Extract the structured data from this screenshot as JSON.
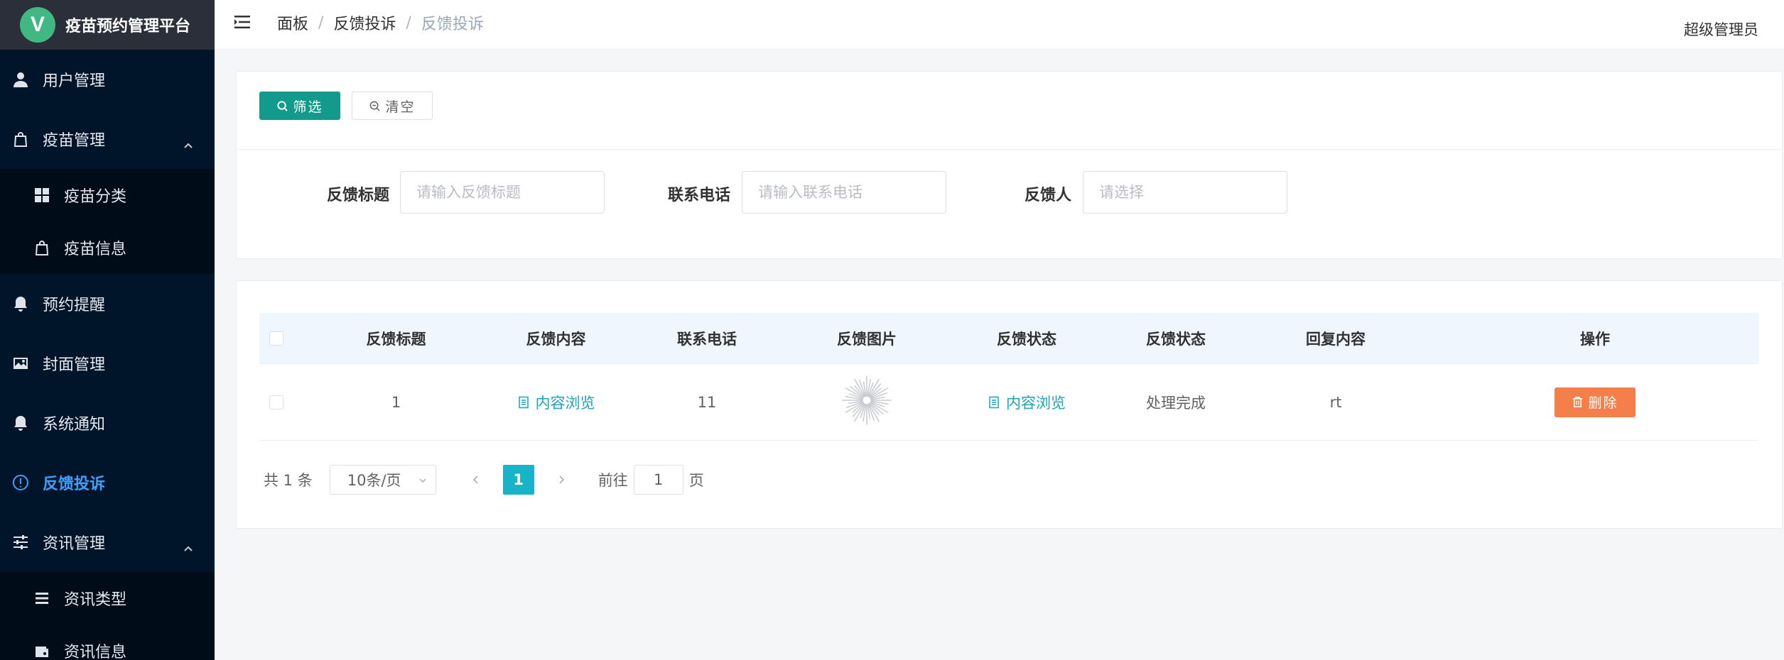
{
  "app": {
    "logo_letter": "V",
    "title": "疫苗预约管理平台"
  },
  "sidebar": {
    "items": [
      {
        "label": "用户管理",
        "icon": "user-icon"
      },
      {
        "label": "疫苗管理",
        "icon": "bag-icon",
        "expanded": true,
        "children": [
          {
            "label": "疫苗分类",
            "icon": "grid-icon"
          },
          {
            "label": "疫苗信息",
            "icon": "bag-icon"
          }
        ]
      },
      {
        "label": "预约提醒",
        "icon": "bell-icon"
      },
      {
        "label": "封面管理",
        "icon": "picture-icon"
      },
      {
        "label": "系统通知",
        "icon": "bell-icon"
      },
      {
        "label": "反馈投诉",
        "icon": "warning-circle-icon",
        "active": true
      },
      {
        "label": "资讯管理",
        "icon": "sliders-icon",
        "expanded": true,
        "children": [
          {
            "label": "资讯类型",
            "icon": "list-icon"
          },
          {
            "label": "资讯信息",
            "icon": "wallet-icon"
          }
        ]
      }
    ]
  },
  "header": {
    "breadcrumb": [
      "面板",
      "反馈投诉",
      "反馈投诉"
    ],
    "separator": "/",
    "user": "超级管理员"
  },
  "filter": {
    "filter_button": "筛选",
    "clear_button": "清空",
    "fields": [
      {
        "label": "反馈标题",
        "placeholder": "请输入反馈标题"
      },
      {
        "label": "联系电话",
        "placeholder": "请输入联系电话"
      },
      {
        "label": "反馈人",
        "placeholder": "请选择"
      }
    ]
  },
  "table": {
    "columns": [
      "反馈标题",
      "反馈内容",
      "联系电话",
      "反馈图片",
      "反馈状态",
      "反馈状态",
      "回复内容",
      "操作"
    ],
    "rows": [
      {
        "title": "1",
        "content_link": "内容浏览",
        "phone": "11",
        "image": "loading-spinner",
        "state_link": "内容浏览",
        "state_text": "处理完成",
        "reply": "rt",
        "delete_label": "删除"
      }
    ]
  },
  "pagination": {
    "total": "共 1 条",
    "page_size": "10条/页",
    "current_page": "1",
    "goto_prefix": "前往",
    "goto_value": "1",
    "goto_suffix": "页"
  },
  "colors": {
    "sidebar_bg": "#001529",
    "active": "#409eff",
    "primary": "#129a8c",
    "link": "#17a5b8",
    "danger": "#f57f4b",
    "page_active": "#17b3c8"
  }
}
